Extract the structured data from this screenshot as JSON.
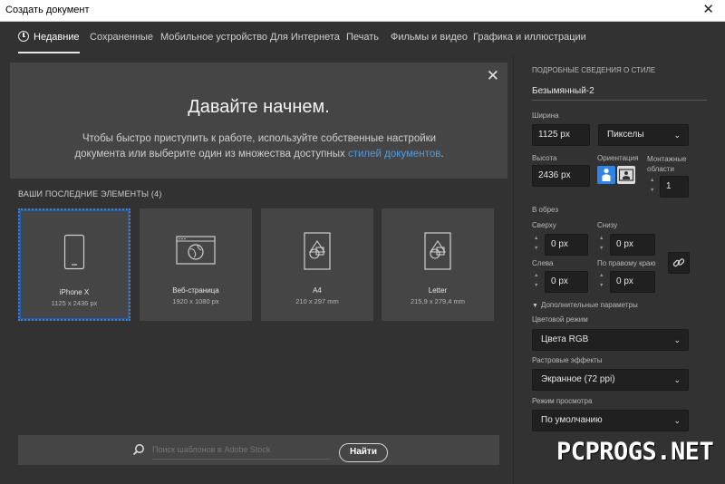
{
  "window": {
    "title": "Создать документ",
    "close": "✕"
  },
  "tabs": [
    {
      "label": "Недавние"
    },
    {
      "label": "Сохраненные"
    },
    {
      "label": "Мобильное устройство"
    },
    {
      "label": "Для Интернета"
    },
    {
      "label": "Печать"
    },
    {
      "label": "Фильмы и видео"
    },
    {
      "label": "Графика и иллюстрации"
    }
  ],
  "welcome": {
    "heading": "Давайте начнем.",
    "desc_line1": "Чтобы быстро приступить к работе, используйте собственные настройки",
    "desc_line2": "документа или выберите один из множества доступных ",
    "desc_link": "стилей документов",
    "desc_end": ".",
    "close": "✕"
  },
  "recent": {
    "heading": "ВАШИ ПОСЛЕДНИЕ ЭЛЕМЕНТЫ",
    "count": "(4)",
    "items": [
      {
        "name": "iPhone X",
        "size": "1125 x 2436 px",
        "icon": "phone-icon"
      },
      {
        "name": "Веб-страница",
        "size": "1920 x 1080 px",
        "icon": "web-page-icon"
      },
      {
        "name": "A4",
        "size": "210 x 297 mm",
        "icon": "document-shapes-icon"
      },
      {
        "name": "Letter",
        "size": "215,9 x 279,4 mm",
        "icon": "document-shapes-icon"
      }
    ]
  },
  "search": {
    "placeholder": "Поиск шаблонов в Adobe Stock",
    "button": "Найти",
    "icon": "search-icon"
  },
  "details": {
    "heading": "ПОДРОБНЫЕ СВЕДЕНИЯ О СТИЛЕ",
    "doc_name": "Безымянный-2",
    "width_label": "Ширина",
    "width_value": "1125 px",
    "units": "Пикселы",
    "height_label": "Высота",
    "height_value": "2436 px",
    "orientation_label": "Ориентация",
    "artboards_label_1": "Монтажные",
    "artboards_label_2": "области",
    "artboards_value": "1",
    "bleed_label": "В обрез",
    "top_label": "Сверху",
    "top_value": "0 px",
    "bottom_label": "Снизу",
    "bottom_value": "0 px",
    "left_label": "Слева",
    "left_value": "0 px",
    "right_label": "По правому краю",
    "right_value": "0 px",
    "advanced_label": "Дополнительные параметры",
    "color_mode_label": "Цветовой режим",
    "color_mode_value": "Цвета RGB",
    "raster_label": "Растровые эффекты",
    "raster_value": "Экранное (72 ppi)",
    "preview_label": "Режим просмотра",
    "preview_value": "По умолчанию"
  },
  "colors": {
    "accent": "#2f84e8",
    "link": "#4e9de8",
    "bg": "#323232",
    "card": "#454545"
  },
  "watermark": "PCPROGS.NET"
}
